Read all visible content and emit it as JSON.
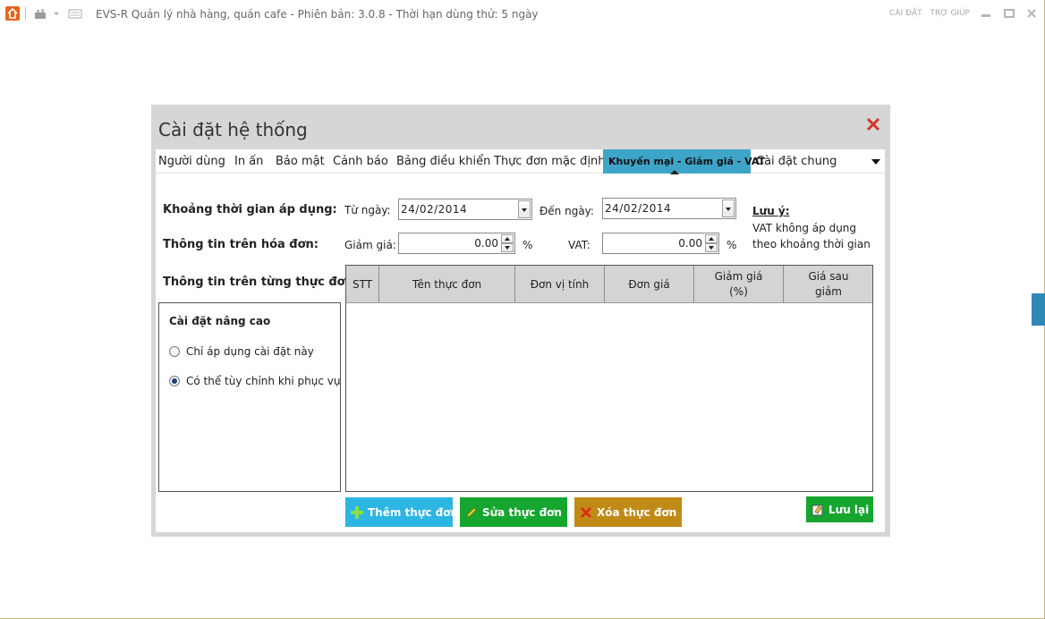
{
  "app": {
    "title": "EVS-R Quản lý nhà hàng, quán cafe - Phiên bản: 3.0.8 - Thời hạn dùng thử: 5 ngày",
    "links": [
      "CÀI ĐẶT",
      "TRỢ GIÚP"
    ],
    "icons": [
      "home-icon",
      "restaurant-icon",
      "dropdown-arrow-icon",
      "keyboard-icon",
      "minimize-icon",
      "maximize-icon",
      "close-icon"
    ]
  },
  "dialog": {
    "title": "Cài đặt hệ thống",
    "tabs": [
      {
        "label": "Người dùng"
      },
      {
        "label": "In ấn"
      },
      {
        "label": "Bảo mật"
      },
      {
        "label": "Cảnh báo"
      },
      {
        "label": "Bảng điều khiển"
      },
      {
        "label": "Thực đơn mặc định"
      },
      {
        "label": "Khuyến mại - Giảm giá - VAT",
        "active": true
      },
      {
        "label": "Cài đặt chung"
      }
    ],
    "form": {
      "period_label": "Khoảng thời gian áp dụng:",
      "from_label": "Từ ngày:",
      "from_value": "24/02/2014",
      "to_label": "Đến ngày:",
      "to_value": "24/02/2014",
      "invoice_label": "Thông tin trên hóa đơn:",
      "discount_label": "Giảm giá:",
      "discount_value": "0.00",
      "discount_unit": "%",
      "vat_label": "VAT:",
      "vat_value": "0.00",
      "vat_unit": "%",
      "menu_label": "Thông tin trên từng thực đơn:"
    },
    "note": {
      "title": "Lưu ý:",
      "text": "VAT không áp dụng theo khoảng thời gian"
    },
    "advanced": {
      "title": "Cài đặt nâng cao",
      "options": [
        {
          "label": "Chỉ áp dụng cài đặt này",
          "selected": false
        },
        {
          "label": "Có thể tùy chỉnh khi phục vụ",
          "selected": true
        }
      ]
    },
    "table": {
      "columns": [
        "STT",
        "Tên thực đơn",
        "Đơn vị tính",
        "Đơn giá",
        "Giảm giá (%)",
        "Giá sau giảm"
      ],
      "rows": []
    },
    "buttons": {
      "add": "Thêm thực đơn",
      "edit": "Sửa thực đơn",
      "delete": "Xóa thực đơn",
      "save": "Lưu lại"
    }
  },
  "colors": {
    "accent_tab": "#3ea5c9",
    "add_button": "#2db5e3",
    "edit_button": "#15a62f",
    "delete_button": "#c08a17",
    "save_button": "#15a62f",
    "close_x": "#d8322b"
  }
}
